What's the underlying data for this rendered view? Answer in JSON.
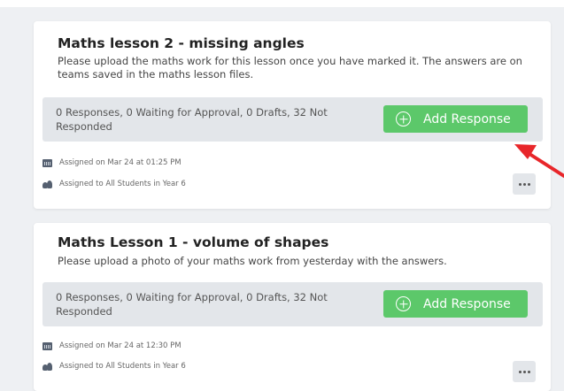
{
  "assignments": [
    {
      "title": "Maths lesson 2 - missing angles",
      "description": "Please upload the maths work for this lesson once you have marked it. The answers are on teams saved in the maths lesson files.",
      "response_status": "0 Responses, 0 Waiting for Approval, 0 Drafts, 32 Not Responded",
      "add_response_label": "Add Response",
      "assigned_on": "Assigned on Mar 24 at 01:25 PM",
      "assigned_to": "Assigned to All Students in Year 6",
      "more_label": "..."
    },
    {
      "title": "Maths Lesson 1 - volume of shapes",
      "description": "Please upload a photo of your maths work from yesterday with the answers.",
      "response_status": "0 Responses, 0 Waiting for Approval, 0 Drafts, 32 Not Responded",
      "add_response_label": "Add Response",
      "assigned_on": "Assigned on Mar 24 at 12:30 PM",
      "assigned_to": "Assigned to All Students in Year 6",
      "more_label": "..."
    }
  ],
  "colors": {
    "add_button": "#5cc86a",
    "annotation_arrow": "#e8262a",
    "response_bar": "#e3e6ea"
  }
}
